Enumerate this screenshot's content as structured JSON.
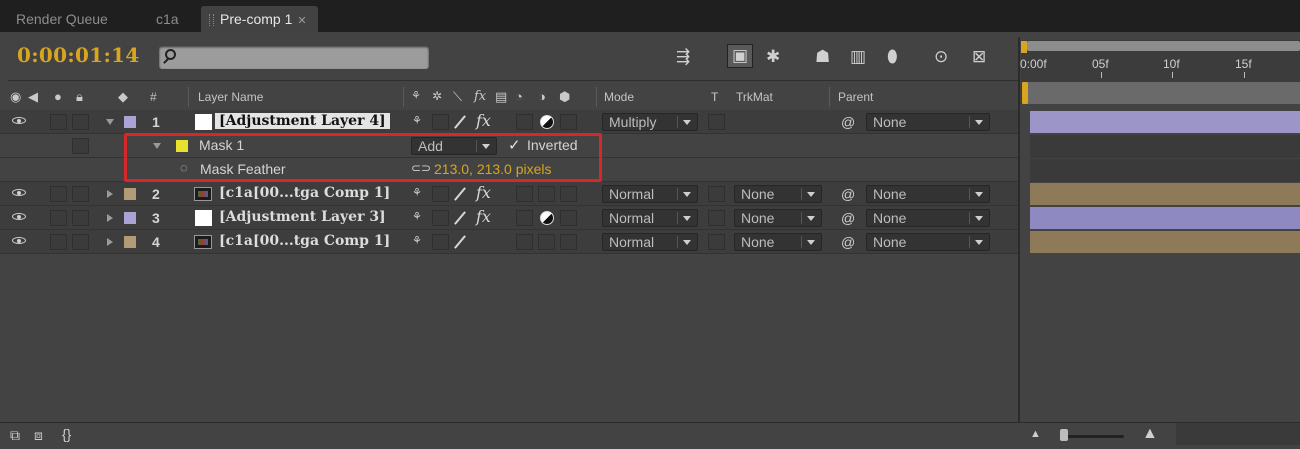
{
  "tabs": [
    {
      "label": "Render Queue"
    },
    {
      "label": "c1a"
    },
    {
      "label": "Pre-comp 1"
    }
  ],
  "timecode": "0:00:01:14",
  "search": {
    "value": "",
    "placeholder": ""
  },
  "toolbar_icons": [
    "composition-mini-flowchart-icon",
    "draft-3d-icon",
    "hide-shy-layers-icon",
    "frame-blending-icon",
    "motion-blur-icon",
    "brainstorm-icon",
    "graph-editor-icon"
  ],
  "headers": {
    "layer_name": "Layer Name",
    "hash": "#",
    "mode": "Mode",
    "t": "T",
    "trkmat": "TrkMat",
    "parent": "Parent"
  },
  "layers": [
    {
      "num": "1",
      "name": "[Adjustment Layer 4]",
      "mode": "Multiply",
      "trkmat": "",
      "parent": "None",
      "label_color": "#a9a3d6"
    },
    {
      "num": "2",
      "name": "[c1a[00...tga Comp 1]",
      "mode": "Normal",
      "trkmat": "None",
      "parent": "None",
      "label_color": "#b29c78"
    },
    {
      "num": "3",
      "name": "[Adjustment Layer 3]",
      "mode": "Normal",
      "trkmat": "None",
      "parent": "None",
      "label_color": "#a9a3d6"
    },
    {
      "num": "4",
      "name": "[c1a[00...tga Comp 1]",
      "mode": "Normal",
      "trkmat": "None",
      "parent": "None",
      "label_color": "#b29c78"
    }
  ],
  "mask": {
    "name": "Mask 1",
    "mode": "Add",
    "inverted_label": "Inverted",
    "inverted": true,
    "feather_label": "Mask Feather",
    "feather_value": "213.0, 213.0 pixels"
  },
  "ruler_labels": [
    "0:00f",
    "05f",
    "10f",
    "15f"
  ],
  "colors": {
    "accent": "#d8a521",
    "highlight": "#d62828",
    "bar_adjustment": "#9c96c8",
    "bar_comp": "#8e7a58"
  }
}
